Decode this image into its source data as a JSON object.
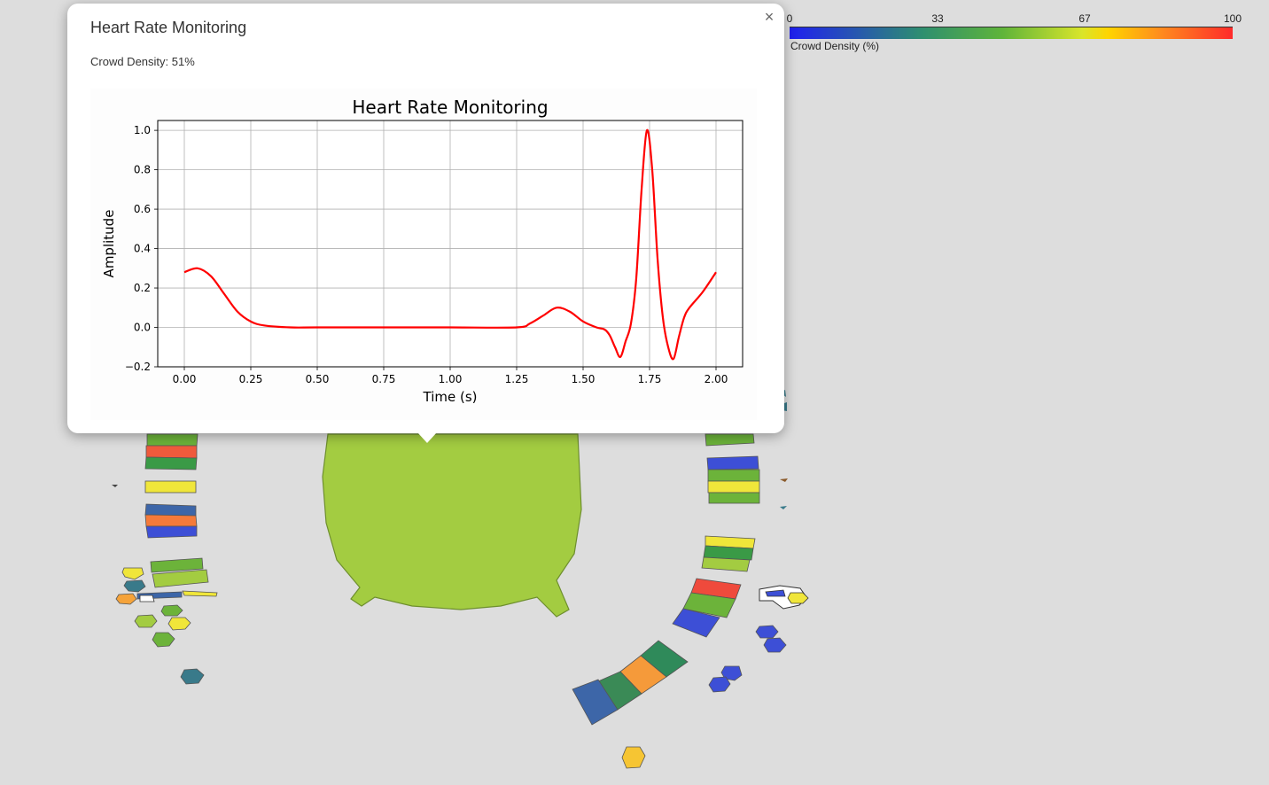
{
  "legend": {
    "ticks": [
      "0",
      "33",
      "67",
      "100"
    ],
    "caption": "Crowd Density (%)"
  },
  "popup": {
    "title": "Heart Rate Monitoring",
    "density_text": "Crowd Density: 51%",
    "close_glyph": "×"
  },
  "chart_data": {
    "type": "line",
    "title": "Heart Rate Monitoring",
    "xlabel": "Time (s)",
    "ylabel": "Amplitude",
    "xlim": [
      -0.1,
      2.1
    ],
    "ylim": [
      -0.2,
      1.05
    ],
    "x_ticks": [
      "0.00",
      "0.25",
      "0.50",
      "0.75",
      "1.00",
      "1.25",
      "1.50",
      "1.75",
      "2.00"
    ],
    "y_ticks": [
      "−0.2",
      "0.0",
      "0.2",
      "0.4",
      "0.6",
      "0.8",
      "1.0"
    ],
    "grid": true,
    "series": [
      {
        "color": "#ff0000",
        "x": [
          0.0,
          0.05,
          0.1,
          0.15,
          0.2,
          0.25,
          0.3,
          0.4,
          0.5,
          0.75,
          1.0,
          1.25,
          1.3,
          1.35,
          1.4,
          1.45,
          1.5,
          1.55,
          1.58,
          1.6,
          1.62,
          1.64,
          1.66,
          1.68,
          1.7,
          1.72,
          1.74,
          1.76,
          1.78,
          1.8,
          1.82,
          1.84,
          1.86,
          1.88,
          1.9,
          1.95,
          2.0
        ],
        "y": [
          0.28,
          0.3,
          0.26,
          0.17,
          0.08,
          0.03,
          0.01,
          0.0,
          0.0,
          0.0,
          0.0,
          0.0,
          0.02,
          0.06,
          0.1,
          0.08,
          0.03,
          0.0,
          -0.01,
          -0.04,
          -0.1,
          -0.15,
          -0.07,
          0.02,
          0.25,
          0.7,
          1.0,
          0.8,
          0.35,
          0.05,
          -0.1,
          -0.16,
          -0.05,
          0.05,
          0.1,
          0.18,
          0.28
        ]
      }
    ]
  },
  "map": {
    "field_color": "#a3cc41",
    "section_colors": [
      "#3d66a8",
      "#ef5a3c",
      "#3a9a46",
      "#f0e63a",
      "#6cb33a",
      "#a3cc41",
      "#f59a3a",
      "#3d4fd6",
      "#2f8a5a",
      "#397a8a",
      "#f6c533"
    ]
  }
}
